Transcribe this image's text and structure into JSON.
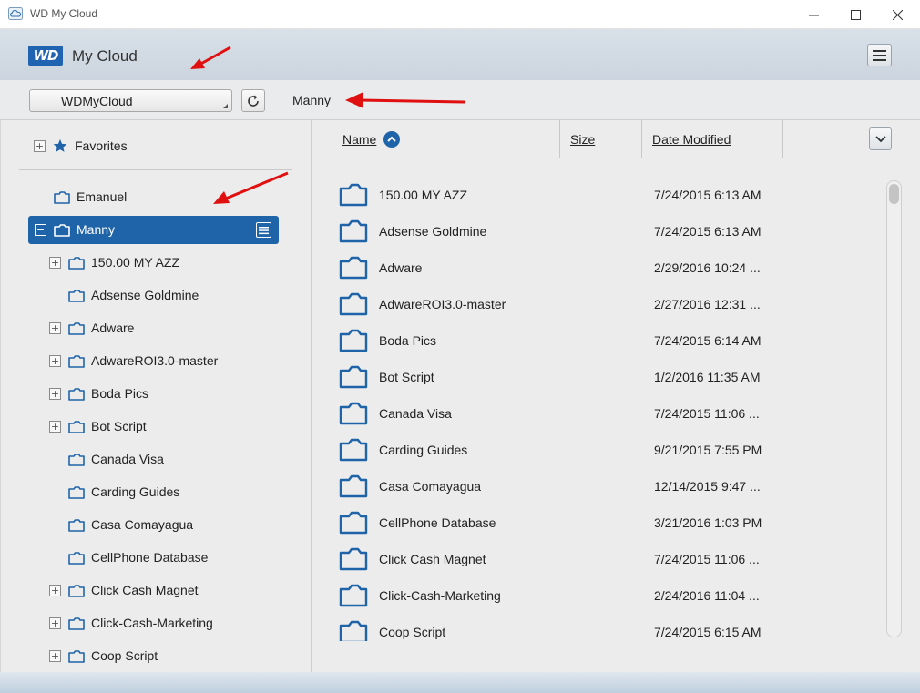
{
  "window": {
    "title": "WD My Cloud",
    "controls": [
      "minimize",
      "maximize",
      "close"
    ]
  },
  "header": {
    "logo_text": "WD",
    "app_name": "My Cloud",
    "menu_icon": "hamburger-icon"
  },
  "toolbar": {
    "device_selected": "WDMyCloud",
    "refresh_icon": "refresh-icon",
    "breadcrumb": "Manny"
  },
  "sidebar": {
    "favorites_label": "Favorites",
    "items": [
      {
        "label": "Emanuel",
        "level": 0,
        "expandable": false
      },
      {
        "label": "Manny",
        "level": 0,
        "expandable": true,
        "expanded": true,
        "selected": true
      },
      {
        "label": "150.00 MY AZZ",
        "level": 1,
        "expandable": true
      },
      {
        "label": "Adsense Goldmine",
        "level": 1,
        "expandable": false
      },
      {
        "label": "Adware",
        "level": 1,
        "expandable": true
      },
      {
        "label": "AdwareROI3.0-master",
        "level": 1,
        "expandable": true
      },
      {
        "label": "Boda Pics",
        "level": 1,
        "expandable": true
      },
      {
        "label": "Bot Script",
        "level": 1,
        "expandable": true
      },
      {
        "label": "Canada Visa",
        "level": 1,
        "expandable": false
      },
      {
        "label": "Carding Guides",
        "level": 1,
        "expandable": false
      },
      {
        "label": "Casa Comayagua",
        "level": 1,
        "expandable": false
      },
      {
        "label": "CellPhone Database",
        "level": 1,
        "expandable": false
      },
      {
        "label": "Click Cash Magnet",
        "level": 1,
        "expandable": true
      },
      {
        "label": "Click-Cash-Marketing",
        "level": 1,
        "expandable": true
      },
      {
        "label": "Coop Script",
        "level": 1,
        "expandable": true
      }
    ]
  },
  "file_list": {
    "columns": {
      "name": "Name",
      "size": "Size",
      "date": "Date Modified"
    },
    "sort": "name-ascending",
    "rows": [
      {
        "name": "150.00 MY AZZ",
        "size": "",
        "date": "7/24/2015 6:13 AM"
      },
      {
        "name": "Adsense Goldmine",
        "size": "",
        "date": "7/24/2015 6:13 AM"
      },
      {
        "name": "Adware",
        "size": "",
        "date": "2/29/2016 10:24 ..."
      },
      {
        "name": "AdwareROI3.0-master",
        "size": "",
        "date": "2/27/2016 12:31 ..."
      },
      {
        "name": "Boda Pics",
        "size": "",
        "date": "7/24/2015 6:14 AM"
      },
      {
        "name": "Bot Script",
        "size": "",
        "date": "1/2/2016 11:35 AM"
      },
      {
        "name": "Canada Visa",
        "size": "",
        "date": "7/24/2015 11:06 ..."
      },
      {
        "name": "Carding Guides",
        "size": "",
        "date": "9/21/2015 7:55 PM"
      },
      {
        "name": "Casa Comayagua",
        "size": "",
        "date": "12/14/2015 9:47 ..."
      },
      {
        "name": "CellPhone Database",
        "size": "",
        "date": "3/21/2016 1:03 PM"
      },
      {
        "name": "Click Cash Magnet",
        "size": "",
        "date": "7/24/2015 11:06 ..."
      },
      {
        "name": "Click-Cash-Marketing",
        "size": "",
        "date": "2/24/2016 11:04 ..."
      },
      {
        "name": "Coop Script",
        "size": "",
        "date": "7/24/2015 6:15 AM"
      }
    ]
  },
  "colors": {
    "accent": "#1f64a8",
    "annotation_arrow": "#e01010"
  }
}
